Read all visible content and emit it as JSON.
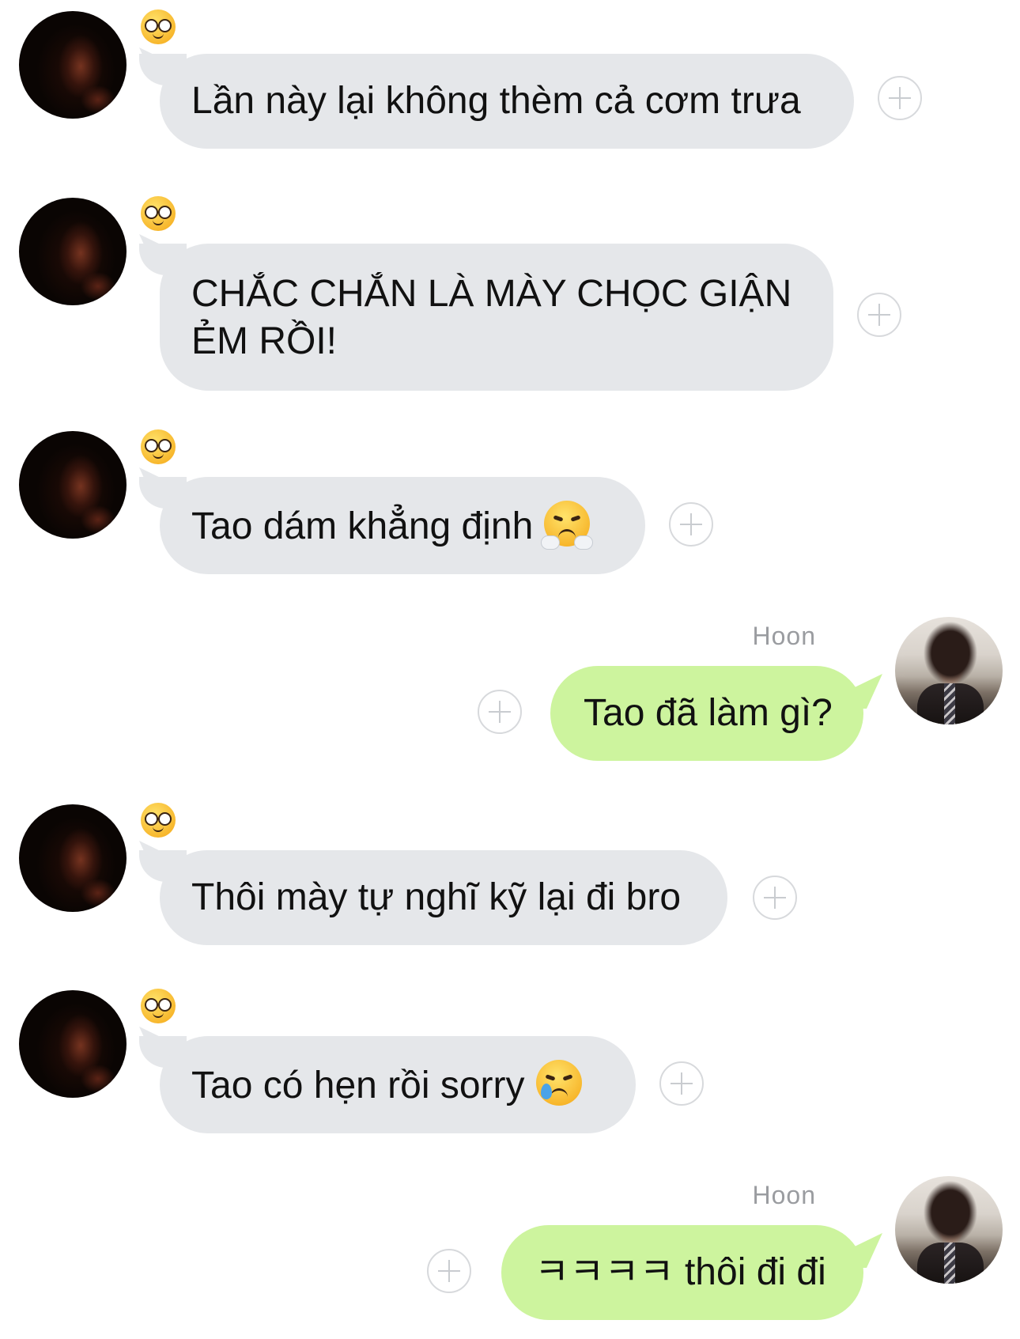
{
  "conversation": {
    "messages": [
      {
        "direction": "incoming",
        "reaction_icon": "nerd-face-icon",
        "text": "Lần này lại không thèm cả cơm trưa"
      },
      {
        "direction": "incoming",
        "reaction_icon": "nerd-face-icon",
        "text_line1": "CHẮC CHẮN LÀ MÀY CHỌC GIẬN",
        "text_line2": "ẺM RỒI!"
      },
      {
        "direction": "incoming",
        "reaction_icon": "nerd-face-icon",
        "text": "Tao dám khẳng định",
        "emoji_icon": "face-with-steam-icon"
      },
      {
        "direction": "outgoing",
        "sender": "Hoon",
        "text": "Tao đã làm gì?"
      },
      {
        "direction": "incoming",
        "reaction_icon": "nerd-face-icon",
        "text": "Thôi mày tự nghĩ kỹ lại đi bro"
      },
      {
        "direction": "incoming",
        "reaction_icon": "nerd-face-icon",
        "text": "Tao có hẹn rồi sorry",
        "emoji_icon": "crying-face-icon"
      },
      {
        "direction": "outgoing",
        "sender": "Hoon",
        "text": "ㅋㅋㅋㅋ thôi đi đi"
      }
    ]
  },
  "colors": {
    "incoming_bubble": "#e5e7ea",
    "outgoing_bubble": "#cdf49e",
    "sender_name": "#9a9ca0"
  }
}
